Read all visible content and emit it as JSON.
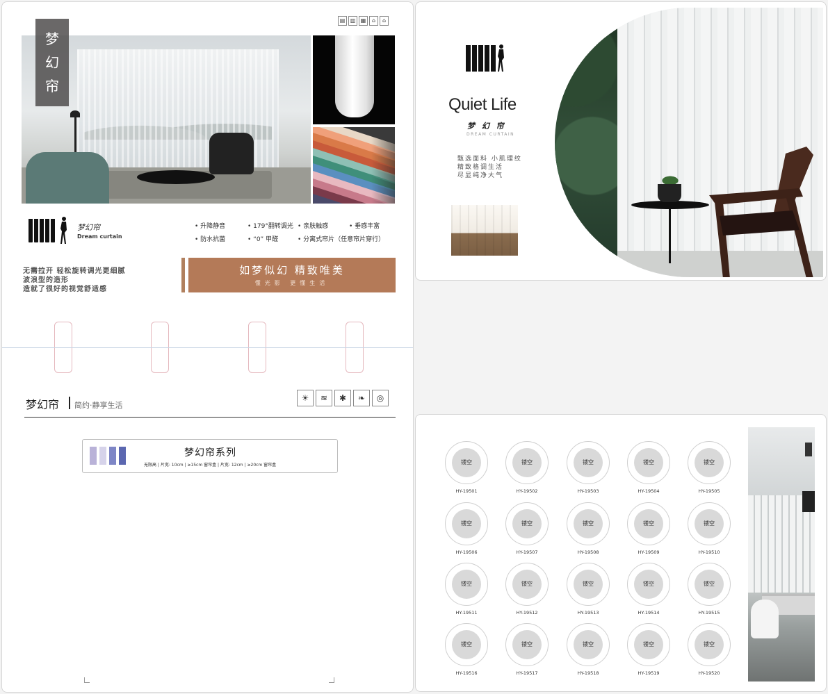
{
  "left_page": {
    "title_chars": [
      "梦",
      "幻",
      "帘"
    ],
    "top_icons": [
      "curtain-icon-1",
      "truck-icon",
      "building-icon",
      "house-icon",
      "home-icon"
    ],
    "brand": {
      "cn": "梦幻帘",
      "en": "Dream curtain"
    },
    "features": [
      "升降静音",
      "179°翻转调光",
      "亲肤触感",
      "垂感丰富",
      "防水抗菌",
      "“0” 甲醛",
      "分离式帘片（任意帘片穿行）"
    ],
    "description_lines": [
      "无需拉开 轻松旋转调光更细腻",
      "波浪型的造形",
      "造就了很好的视觉舒适感"
    ],
    "banner": {
      "main": "如梦似幻  精致唯美",
      "sub": "懂光影  更懂生活"
    },
    "section": {
      "title": "梦幻帘",
      "subtitle": "简约·静享生活"
    },
    "section_icons": [
      "sun-icon",
      "sunset-icon",
      "star-icon",
      "leaf-icon",
      "circles-icon"
    ],
    "series": {
      "title": "梦幻帘系列",
      "spec": "无限高 | 片宽: 10cm  |  ≥15cm 窗帘盒 | 片宽: 12cm  |  ≥20cm 窗帘盒",
      "chip_colors": [
        "#b9b2d8",
        "#d6d3ea",
        "#7e86c6",
        "#5b67b0"
      ]
    },
    "swatch_colors": [
      "#e8d8c6",
      "#f0a07a",
      "#d97a48",
      "#c85a3a",
      "#8fc0b5",
      "#3f8f7a",
      "#5a8fc0",
      "#e8b9c0",
      "#c77a8a",
      "#7a3a4a",
      "#4a4a6a"
    ]
  },
  "right_top": {
    "title": "Quiet Life",
    "brand_cn": "梦 幻 帘",
    "brand_en": "DREAM CURTAIN",
    "description_lines": [
      "甄选面料 小肌理纹",
      "精致格调生活",
      "尽显纯净大气"
    ]
  },
  "right_bottom": {
    "swatch_label": "镂空",
    "codes": [
      "HY-19501",
      "HY-19502",
      "HY-19503",
      "HY-19504",
      "HY-19505",
      "HY-19506",
      "HY-19507",
      "HY-19508",
      "HY-19509",
      "HY-19510",
      "HY-19511",
      "HY-19512",
      "HY-19513",
      "HY-19514",
      "HY-19515",
      "HY-19516",
      "HY-19517",
      "HY-19518",
      "HY-19519",
      "HY-19520"
    ]
  }
}
